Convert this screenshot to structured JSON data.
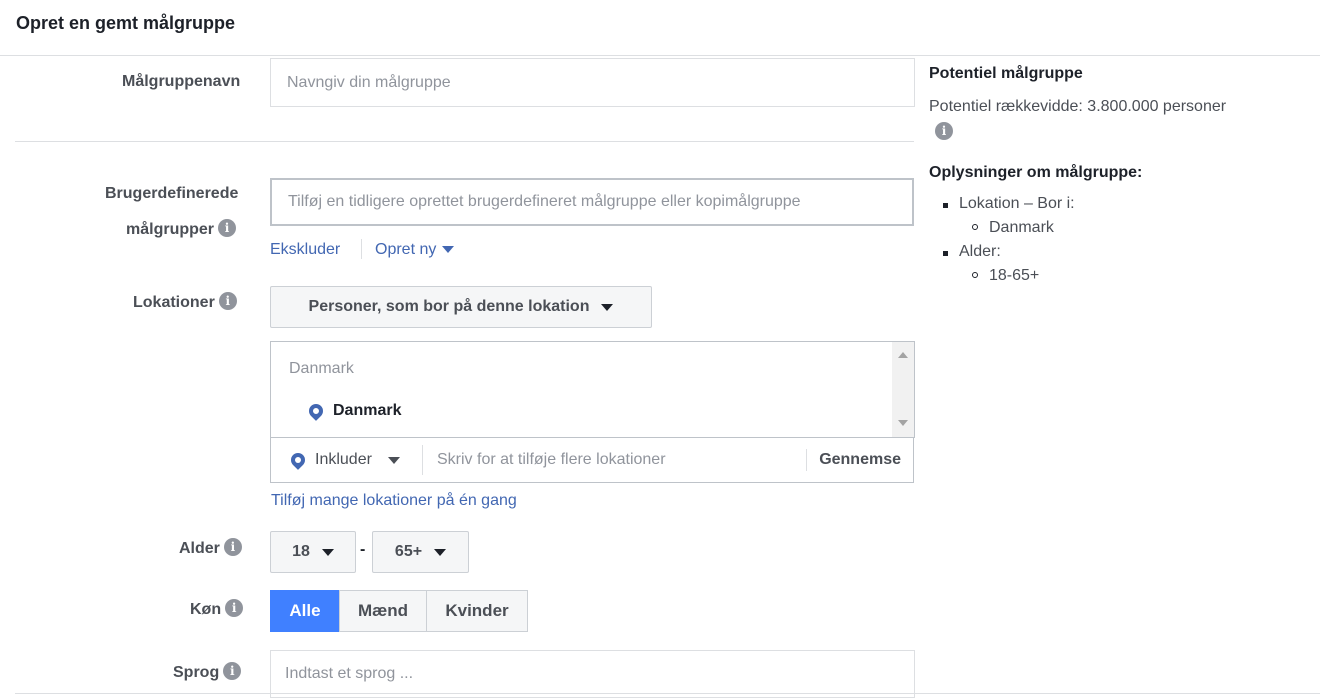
{
  "header": {
    "title": "Opret en gemt målgruppe"
  },
  "form": {
    "name": {
      "label": "Målgruppenavn",
      "placeholder": "Navngiv din målgruppe"
    },
    "custom": {
      "label_line1": "Brugerdefinerede",
      "label_line2": "målgrupper",
      "placeholder": "Tilføj en tidligere oprettet brugerdefineret målgruppe eller kopimålgruppe",
      "exclude_link": "Ekskluder",
      "create_link": "Opret ny"
    },
    "locations": {
      "label": "Lokationer",
      "type_dropdown": "Personer, som bor på denne lokation",
      "group_title": "Danmark",
      "selected_item": "Danmark",
      "include_dropdown": "Inkluder",
      "search_placeholder": "Skriv for at tilføje flere lokationer",
      "browse_label": "Gennemse",
      "bulk_link": "Tilføj mange lokationer på én gang"
    },
    "age": {
      "label": "Alder",
      "min": "18",
      "separator": "-",
      "max": "65+"
    },
    "gender": {
      "label": "Køn",
      "options": [
        "Alle",
        "Mænd",
        "Kvinder"
      ],
      "selected": "Alle"
    },
    "language": {
      "label": "Sprog",
      "placeholder": "Indtast et sprog ..."
    }
  },
  "sidebar": {
    "potential_title": "Potentiel målgruppe",
    "reach_text": "Potentiel rækkevidde: 3.800.000 personer",
    "details_title": "Oplysninger om målgruppe:",
    "location_item": "Lokation – Bor i:",
    "location_value": "Danmark",
    "age_item": "Alder:",
    "age_value": "18-65+"
  },
  "colors": {
    "accent": "#4080ff",
    "link": "#4267b2",
    "pin": "#4267b2"
  },
  "icons": {
    "info": "info-icon",
    "pin": "location-pin-icon",
    "caret": "caret-down-icon"
  }
}
